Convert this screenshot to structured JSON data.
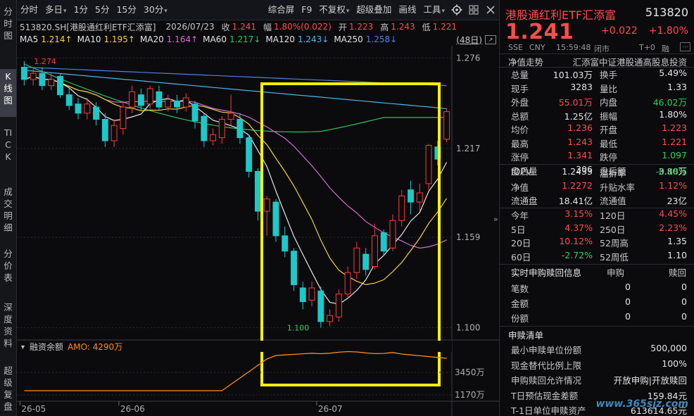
{
  "left_tabs": [
    {
      "label": "分时图",
      "active": false
    },
    {
      "label": "K线图",
      "active": true
    },
    {
      "label": "TICK",
      "active": false
    },
    {
      "label": "成交明细",
      "active": false
    },
    {
      "label": "分价表",
      "active": false
    },
    {
      "label": "深度资料",
      "active": false
    },
    {
      "label": "超级复盘",
      "active": false
    }
  ],
  "toolbar": {
    "period_buttons": [
      "分时",
      "多日",
      "1分",
      "5分",
      "15分",
      "30分"
    ],
    "right_buttons": [
      "综合屏",
      "F9",
      "不复权",
      "超级叠加",
      "画线",
      "工具"
    ]
  },
  "info": {
    "code_name": "513820.SH[港股通红利ETF汇添富]",
    "date": "2026/07/23",
    "close_label": "收",
    "close": "1.241",
    "change_label": "幅",
    "change": "1.80%(0.022)",
    "open_label": "开",
    "open": "1.223",
    "high_label": "高",
    "high": "1.243",
    "low_label": "低",
    "low": "1.221"
  },
  "ma_legend": [
    {
      "name": "MA5",
      "value": "1.214↑",
      "color": "#e6e6e6",
      "vcolor": "#f5d142"
    },
    {
      "name": "MA10",
      "value": "1.195↑",
      "color": "#e6e6e6",
      "vcolor": "#f5d142"
    },
    {
      "name": "MA20",
      "value": "1.164↑",
      "color": "#e6e6e6",
      "vcolor": "#d66bd6"
    },
    {
      "name": "MA60",
      "value": "1.217↓",
      "color": "#e6e6e6",
      "vcolor": "#2ec45a"
    },
    {
      "name": "MA120",
      "value": "1.243↓",
      "color": "#e6e6e6",
      "vcolor": "#4fb6e8"
    },
    {
      "name": "MA250",
      "value": "1.258↓",
      "color": "#e6e6e6",
      "vcolor": "#4f7fe8"
    }
  ],
  "bars_count": "(48日)",
  "y_axis_labels": [
    "1.276",
    "1.217",
    "1.159",
    "1.100"
  ],
  "max_label": "1.274",
  "min_label": "1.100",
  "x_axis_labels": [
    "26-05",
    "26-06",
    "26-07"
  ],
  "sub_panel": {
    "title": "融资余额",
    "amo_label": "AMO: 4290万",
    "y_labels": [
      "3450万",
      "1170万"
    ]
  },
  "colors": {
    "up": "#ff3b3b",
    "down": "#1ec8c8",
    "ma5": "#e6e6e6",
    "ma10": "#f5d142",
    "ma20": "#d66bd6",
    "ma60": "#2ec45a",
    "ma120": "#4fb6e8",
    "ma250": "#4f7fe8",
    "highlight": "#f7f000",
    "amo": "#ff8c1a"
  },
  "chart_data": {
    "type": "candlestick",
    "series": [
      {
        "date_index": 0,
        "open": 1.27,
        "close": 1.262,
        "high": 1.274,
        "low": 1.258
      },
      {
        "date_index": 1,
        "open": 1.262,
        "close": 1.266,
        "high": 1.27,
        "low": 1.258
      },
      {
        "date_index": 2,
        "open": 1.266,
        "close": 1.258,
        "high": 1.27,
        "low": 1.255
      },
      {
        "date_index": 3,
        "open": 1.258,
        "close": 1.262,
        "high": 1.266,
        "low": 1.255
      },
      {
        "date_index": 4,
        "open": 1.264,
        "close": 1.252,
        "high": 1.266,
        "low": 1.25
      },
      {
        "date_index": 5,
        "open": 1.252,
        "close": 1.245,
        "high": 1.256,
        "low": 1.242
      },
      {
        "date_index": 6,
        "open": 1.246,
        "close": 1.24,
        "high": 1.25,
        "low": 1.236
      },
      {
        "date_index": 7,
        "open": 1.24,
        "close": 1.246,
        "high": 1.25,
        "low": 1.236
      },
      {
        "date_index": 8,
        "open": 1.244,
        "close": 1.236,
        "high": 1.247,
        "low": 1.232
      },
      {
        "date_index": 9,
        "open": 1.236,
        "close": 1.222,
        "high": 1.24,
        "low": 1.218
      },
      {
        "date_index": 10,
        "open": 1.222,
        "close": 1.232,
        "high": 1.236,
        "low": 1.218
      },
      {
        "date_index": 11,
        "open": 1.23,
        "close": 1.244,
        "high": 1.248,
        "low": 1.226
      },
      {
        "date_index": 12,
        "open": 1.244,
        "close": 1.254,
        "high": 1.258,
        "low": 1.24
      },
      {
        "date_index": 13,
        "open": 1.252,
        "close": 1.245,
        "high": 1.256,
        "low": 1.242
      },
      {
        "date_index": 14,
        "open": 1.246,
        "close": 1.256,
        "high": 1.258,
        "low": 1.243
      },
      {
        "date_index": 15,
        "open": 1.254,
        "close": 1.244,
        "high": 1.258,
        "low": 1.242
      },
      {
        "date_index": 16,
        "open": 1.244,
        "close": 1.249,
        "high": 1.252,
        "low": 1.241
      },
      {
        "date_index": 17,
        "open": 1.248,
        "close": 1.244,
        "high": 1.252,
        "low": 1.24
      },
      {
        "date_index": 18,
        "open": 1.244,
        "close": 1.25,
        "high": 1.253,
        "low": 1.241
      },
      {
        "date_index": 19,
        "open": 1.246,
        "close": 1.235,
        "high": 1.248,
        "low": 1.23
      },
      {
        "date_index": 20,
        "open": 1.238,
        "close": 1.222,
        "high": 1.24,
        "low": 1.218
      },
      {
        "date_index": 21,
        "open": 1.222,
        "close": 1.226,
        "high": 1.23,
        "low": 1.219
      },
      {
        "date_index": 22,
        "open": 1.224,
        "close": 1.236,
        "high": 1.238,
        "low": 1.22
      },
      {
        "date_index": 23,
        "open": 1.236,
        "close": 1.24,
        "high": 1.252,
        "low": 1.232
      },
      {
        "date_index": 24,
        "open": 1.236,
        "close": 1.224,
        "high": 1.24,
        "low": 1.22
      },
      {
        "date_index": 25,
        "open": 1.224,
        "close": 1.202,
        "high": 1.226,
        "low": 1.198
      },
      {
        "date_index": 26,
        "open": 1.202,
        "close": 1.176,
        "high": 1.204,
        "low": 1.17
      },
      {
        "date_index": 27,
        "open": 1.176,
        "close": 1.184,
        "high": 1.186,
        "low": 1.16
      },
      {
        "date_index": 28,
        "open": 1.182,
        "close": 1.16,
        "high": 1.184,
        "low": 1.156
      },
      {
        "date_index": 29,
        "open": 1.16,
        "close": 1.15,
        "high": 1.166,
        "low": 1.146
      },
      {
        "date_index": 30,
        "open": 1.15,
        "close": 1.128,
        "high": 1.152,
        "low": 1.124
      },
      {
        "date_index": 31,
        "open": 1.126,
        "close": 1.117,
        "high": 1.13,
        "low": 1.112
      },
      {
        "date_index": 32,
        "open": 1.118,
        "close": 1.126,
        "high": 1.13,
        "low": 1.114
      },
      {
        "date_index": 33,
        "open": 1.124,
        "close": 1.104,
        "high": 1.127,
        "low": 1.1
      },
      {
        "date_index": 34,
        "open": 1.104,
        "close": 1.108,
        "high": 1.112,
        "low": 1.101
      },
      {
        "date_index": 35,
        "open": 1.107,
        "close": 1.122,
        "high": 1.125,
        "low": 1.104
      },
      {
        "date_index": 36,
        "open": 1.122,
        "close": 1.136,
        "high": 1.14,
        "low": 1.12
      },
      {
        "date_index": 37,
        "open": 1.136,
        "close": 1.152,
        "high": 1.156,
        "low": 1.132
      },
      {
        "date_index": 38,
        "open": 1.148,
        "close": 1.138,
        "high": 1.152,
        "low": 1.134
      },
      {
        "date_index": 39,
        "open": 1.14,
        "close": 1.16,
        "high": 1.168,
        "low": 1.138
      },
      {
        "date_index": 40,
        "open": 1.162,
        "close": 1.15,
        "high": 1.164,
        "low": 1.147
      },
      {
        "date_index": 41,
        "open": 1.152,
        "close": 1.17,
        "high": 1.174,
        "low": 1.15
      },
      {
        "date_index": 42,
        "open": 1.17,
        "close": 1.186,
        "high": 1.19,
        "low": 1.166
      },
      {
        "date_index": 43,
        "open": 1.19,
        "close": 1.182,
        "high": 1.196,
        "low": 1.174
      },
      {
        "date_index": 44,
        "open": 1.182,
        "close": 1.188,
        "high": 1.194,
        "low": 1.176
      },
      {
        "date_index": 45,
        "open": 1.194,
        "close": 1.219,
        "high": 1.22,
        "low": 1.19
      },
      {
        "date_index": 46,
        "open": 1.218,
        "close": 1.21,
        "high": 1.222,
        "low": 1.206
      },
      {
        "date_index": 47,
        "open": 1.223,
        "close": 1.241,
        "high": 1.243,
        "low": 1.221
      }
    ],
    "ylim": [
      1.092,
      1.284
    ]
  },
  "quote": {
    "name": "港股通红利ETF汇添富",
    "code": "513820",
    "price": "1.241",
    "change": "+0.022",
    "change_pct": "+1.80%",
    "market": "SSE",
    "currency": "CNY",
    "time": "15:59:48",
    "status": "闭市",
    "tplus": "T+0",
    "rong": "融"
  },
  "nav_row": {
    "label": "净值走势",
    "desc": "汇添富中证港股通高股息投资"
  },
  "stats_a": [
    {
      "k1": "总量",
      "v1": "101.03万",
      "c1": "white",
      "k2": "换手",
      "v2": "5.49%",
      "c2": "white"
    },
    {
      "k1": "现手",
      "v1": "3283",
      "c1": "white",
      "k2": "量比",
      "v2": "1.33",
      "c2": "white"
    },
    {
      "k1": "外盘",
      "v1": "55.01万",
      "c1": "red",
      "k2": "内盘",
      "v2": "46.02万",
      "c2": "green"
    },
    {
      "k1": "总额",
      "v1": "1.25亿",
      "c1": "white",
      "k2": "振幅",
      "v2": "1.80%",
      "c2": "white"
    },
    {
      "k1": "均价",
      "v1": "1.236",
      "c1": "red",
      "k2": "开盘",
      "v2": "1.223",
      "c2": "red"
    },
    {
      "k1": "最高",
      "v1": "1.243",
      "c1": "red",
      "k2": "最低",
      "v2": "1.221",
      "c2": "red"
    },
    {
      "k1": "涨停",
      "v1": "1.341",
      "c1": "red",
      "k2": "跌停",
      "v2": "1.097",
      "c2": "green"
    },
    {
      "k1": "盘后量",
      "v1": "306",
      "c1": "white",
      "k2": "盘后额",
      "v2": "3.80万",
      "c2": "white"
    }
  ],
  "stats_b": [
    {
      "k1": "IOPV",
      "v1": "1.2433",
      "c1": "white",
      "k2": "溢折率",
      "v2": "-0.18%",
      "c2": "green"
    },
    {
      "k1": "净值",
      "v1": "1.2272",
      "c1": "red",
      "k2": "升贴水率",
      "v2": "1.12%",
      "c2": "red"
    },
    {
      "k1": "流通盘",
      "v1": "18.41亿",
      "c1": "white",
      "k2": "流通值",
      "v2": "23亿",
      "c2": "white"
    }
  ],
  "stats_c": [
    {
      "k1": "今年",
      "v1": "3.15%",
      "c1": "red",
      "k2": "120日",
      "v2": "4.45%",
      "c2": "red"
    },
    {
      "k1": "5日",
      "v1": "4.37%",
      "c1": "red",
      "k2": "250日",
      "v2": "2.23%",
      "c2": "red"
    },
    {
      "k1": "20日",
      "v1": "10.12%",
      "c1": "red",
      "k2": "52周高",
      "v2": "1.35",
      "c2": "white"
    },
    {
      "k1": "60日",
      "v1": "-2.72%",
      "c1": "green",
      "k2": "52周低",
      "v2": "1.10",
      "c2": "white"
    }
  ],
  "redeem": {
    "title": "实时申购赎回信息",
    "col1": "申购",
    "col2": "赎回",
    "rows": [
      {
        "k": "笔数",
        "v1": "0",
        "v2": "0"
      },
      {
        "k": "金额",
        "v1": "0",
        "v2": "0"
      },
      {
        "k": "份额",
        "v1": "0",
        "v2": "0"
      }
    ]
  },
  "list": {
    "title": "申赎清单",
    "rows": [
      {
        "k": "最小申赎单位份额",
        "v": "500,000"
      },
      {
        "k": "现金替代比例上限",
        "v": "100%"
      },
      {
        "k": "申购赎回允许情况",
        "v": "开放申购|开放赎回"
      },
      {
        "k": "T日预估现金差额",
        "v": "159.84元"
      },
      {
        "k": "T-1日单位申赎资产",
        "v": "613614.65元"
      }
    ]
  },
  "watermark": "www.365sjz.com"
}
